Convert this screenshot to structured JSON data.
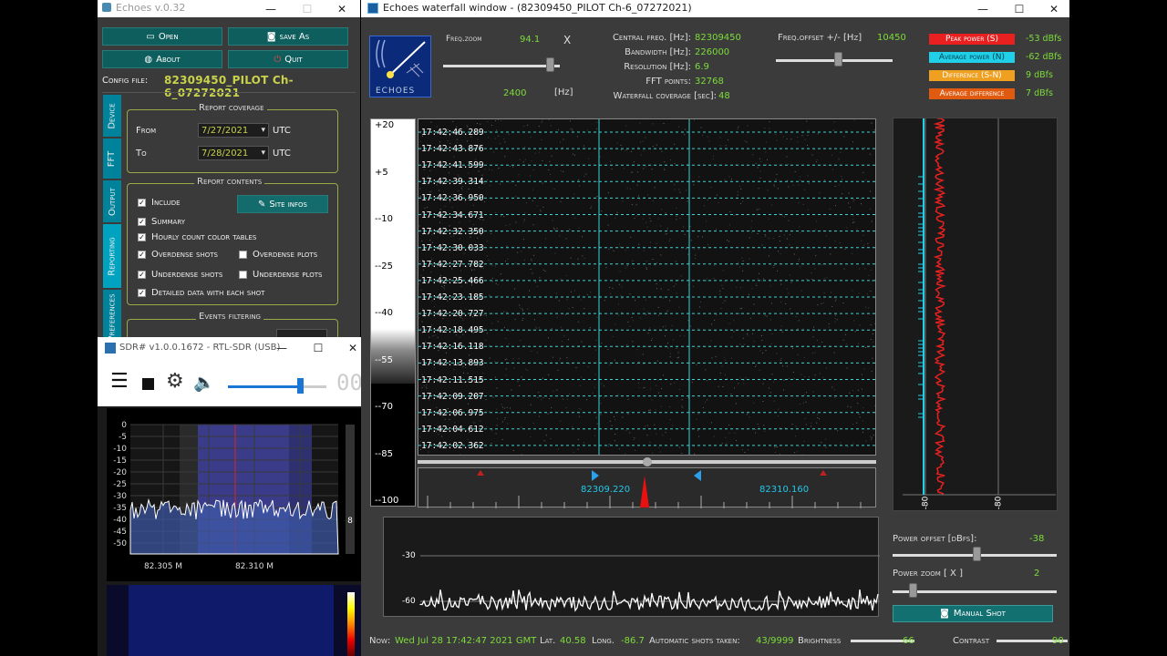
{
  "echoes_main": {
    "title": "Echoes v.0.32",
    "buttons": {
      "open": "Open",
      "save_as": "save As",
      "about": "About",
      "quit": "Quit"
    },
    "config_label": "Config file:",
    "config_value": "82309450_PILOT Ch-6_07272021",
    "tabs": [
      "Device",
      "FFT",
      "Output",
      "Reporting",
      "Preferences"
    ],
    "report_coverage": {
      "title": "Report coverage",
      "from_label": "From",
      "from_value": "7/27/2021",
      "to_label": "To",
      "to_value": "7/28/2021",
      "utc": "UTC"
    },
    "report_contents": {
      "title": "Report contents",
      "include": "Include",
      "site_infos": "Site infos",
      "summary": "Summary",
      "hourly": "Hourly count color tables",
      "overdense_shots": "Overdense shots",
      "overdense_plots": "Overdense plots",
      "underdense_shots": "Underdense shots",
      "underdense_plots": "Underdense plots",
      "detailed": "Detailed data with each shot"
    },
    "events_filtering": "Events filtering"
  },
  "sdr": {
    "title": "SDR# v1.0.0.1672 - RTL-SDR (USB)",
    "y_ticks": [
      "0",
      "-5",
      "-10",
      "-15",
      "-20",
      "-25",
      "-30",
      "-35",
      "-40",
      "-45",
      "-50"
    ],
    "x_ticks": [
      "82.305 M",
      "82.310 M"
    ],
    "side_value": "8",
    "freq_partial": "00"
  },
  "waterfall": {
    "title": "Echoes waterfall window - (82309450_PILOT Ch-6_07272021)",
    "logo_text": "ECHOES",
    "freq_zoom_label": "Freq.zoom",
    "freq_zoom_value": "94.1",
    "freq_zoom_x": "X",
    "freq_span_value": "2400",
    "freq_span_unit": "[Hz]",
    "central_freq_label": "Central freq. [Hz]:",
    "central_freq_value": "82309450",
    "bandwidth_label": "Bandwidth [Hz]:",
    "bandwidth_value": "226000",
    "resolution_label": "Resolution [Hz]:",
    "resolution_value": "6.9",
    "fft_label": "FFT points:",
    "fft_value": "32768",
    "coverage_label": "Waterfall coverage [sec]:",
    "coverage_value": "48",
    "freq_offset_label": "Freq.offset +/- [Hz]",
    "freq_offset_value": "10450",
    "stats": [
      {
        "label": "Peak power (S)",
        "value": "-53 dBfs",
        "color": "#e82020"
      },
      {
        "label": "Average power (N)",
        "value": "-62 dBfs",
        "color": "#20d0e8"
      },
      {
        "label": "Difference (S-N)",
        "value": "9 dBfs",
        "color": "#f0a020"
      },
      {
        "label": "Average difference",
        "value": "7 dBfs",
        "color": "#e05a10"
      }
    ],
    "scale_ticks": [
      "+20",
      "+5",
      "--10",
      "--25",
      "--40",
      "--55",
      "--70",
      "--85",
      "--100"
    ],
    "timestamps": [
      "17:42:46.289",
      "17:42:43.876",
      "17:42:41.599",
      "17:42:39.314",
      "17:42:36.950",
      "17:42:34.671",
      "17:42:32.350",
      "17:42:30.033",
      "17:42:27.782",
      "17:42:25.466",
      "17:42:23.185",
      "17:42:20.727",
      "17:42:18.495",
      "17:42:16.118",
      "17:42:13.893",
      "17:42:11.515",
      "17:42:09.207",
      "17:42:06.975",
      "17:42:04.612",
      "17:42:02.362"
    ],
    "ruler_left": "82309.220",
    "ruler_right": "82310.160",
    "power_ticks": [
      "-30",
      "-60"
    ],
    "vplot_ticks": [
      "-80",
      "-80"
    ],
    "power_offset_label": "Power offset [dBfs]:",
    "power_offset_value": "-38",
    "power_zoom_label": "Power zoom [ X ]",
    "power_zoom_value": "2",
    "manual_shot": "Manual Shot",
    "status": {
      "now_label": "Now:",
      "now_value": "Wed Jul 28 17:42:47 2021 GMT",
      "lat_label": "Lat.",
      "lat_value": "40.58",
      "long_label": "Long.",
      "long_value": "-86.7",
      "shots_label": "Automatic shots taken:",
      "shots_value": "43/9999",
      "brightness_label": "Brightness",
      "brightness_value": "66",
      "contrast_label": "Contrast",
      "contrast_value": "90"
    }
  }
}
